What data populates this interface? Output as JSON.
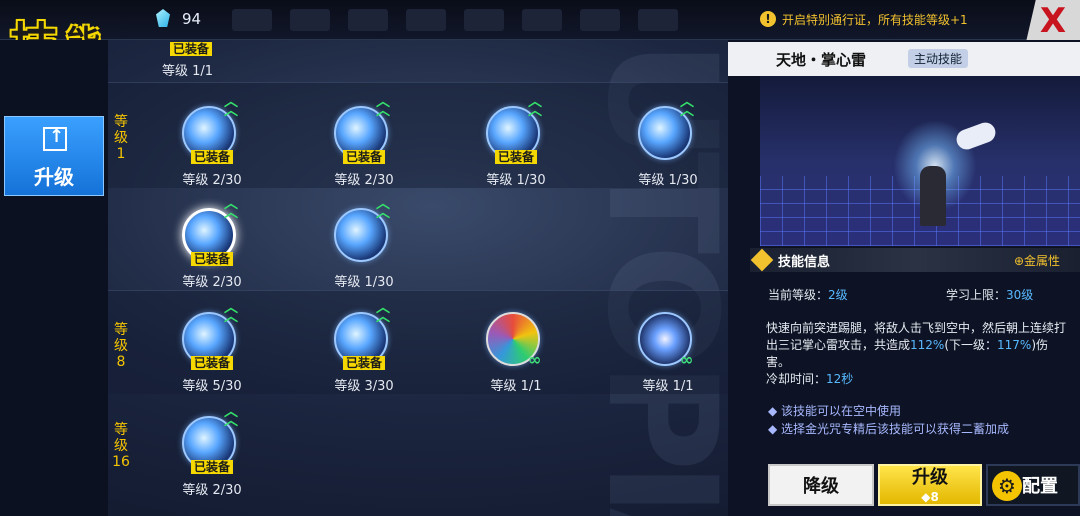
{
  "header": {
    "title_1": "技",
    "title_2": "能",
    "currency": "94",
    "notice_icon": "!",
    "notice": "开启特别通行证，所有技能等级+1",
    "close_icon": "X"
  },
  "sidebar": {
    "upgrade_tab": "升级"
  },
  "grid": {
    "top_partial": {
      "equipped": "已装备",
      "level": "等级 1/1"
    },
    "level_labels": [
      "等\n级\n1",
      "等\n级\n8",
      "等\n级\n16"
    ],
    "skills": [
      {
        "level": "等级 2/30",
        "equipped": "已装备",
        "upgradable": true
      },
      {
        "level": "等级 2/30",
        "equipped": "已装备",
        "upgradable": true
      },
      {
        "level": "等级 1/30",
        "equipped": "已装备",
        "upgradable": true
      },
      {
        "level": "等级 1/30",
        "equipped": "",
        "upgradable": true
      },
      {
        "level": "等级 2/30",
        "equipped": "已装备",
        "upgradable": true,
        "selected": true
      },
      {
        "level": "等级 1/30",
        "equipped": "",
        "upgradable": true
      },
      {
        "level": "等级 5/30",
        "equipped": "已装备",
        "upgradable": true
      },
      {
        "level": "等级 3/30",
        "equipped": "已装备",
        "upgradable": true
      },
      {
        "level": "等级 1/1",
        "equipped": "",
        "upgradable": false,
        "infinite": true
      },
      {
        "level": "等级 1/1",
        "equipped": "",
        "upgradable": false,
        "infinite": true
      },
      {
        "level": "等级 2/30",
        "equipped": "已装备",
        "upgradable": true
      }
    ]
  },
  "panel": {
    "name": "天地・掌心雷",
    "type": "主动技能",
    "info_title": "技能信息",
    "attribute": "⊕金属性",
    "current_level_label": "当前等级：",
    "current_level": "2级",
    "max_level_label": "学习上限：",
    "max_level": "30级",
    "desc_1": "快速向前突进踢腿，将敌人击飞到空中，然后朝上连续打出三记掌心雷攻击，共造成",
    "desc_pct": "112%",
    "desc_2": "(下一级：",
    "desc_next": "117%",
    "desc_3": ")伤害。",
    "cooldown_label": "冷却时间：",
    "cooldown": "12秒",
    "note_1": "◆ 该技能可以在空中使用",
    "note_2": "◆ 选择金光咒专精后该技能可以获得二蓄加成",
    "btn_down": "降级",
    "btn_up": "升级",
    "btn_up_cost": "8",
    "btn_config": "配置"
  }
}
